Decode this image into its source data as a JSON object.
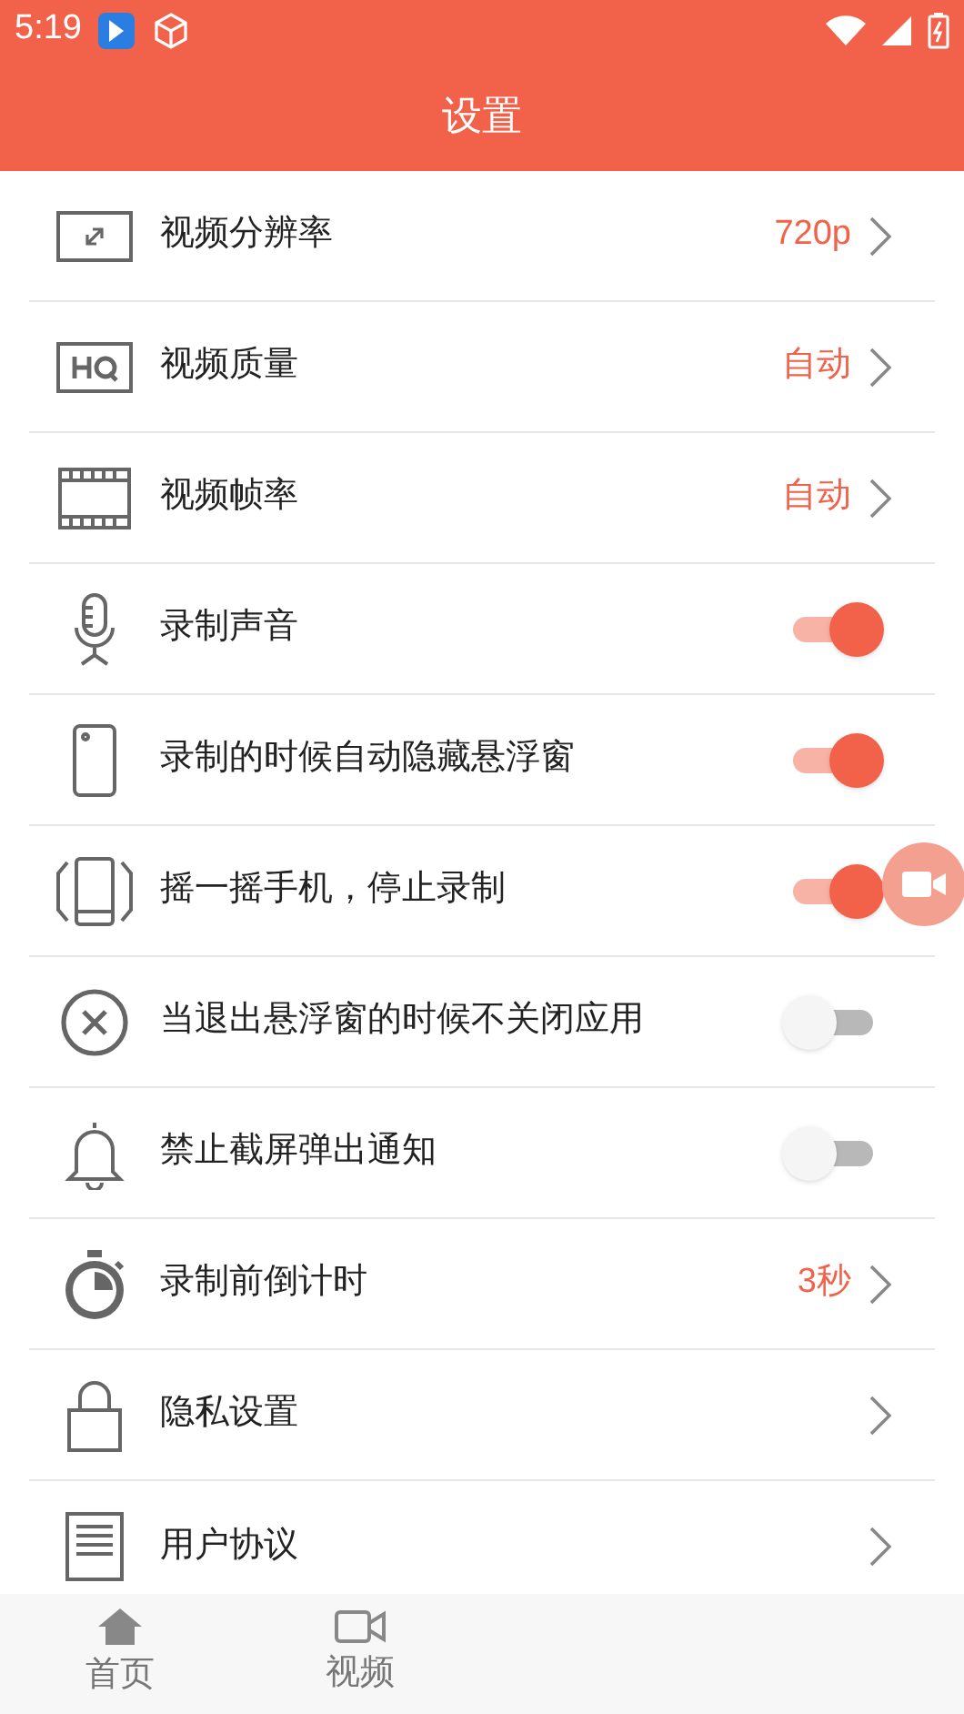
{
  "status_bar": {
    "time": "5:19"
  },
  "header": {
    "title": "设置"
  },
  "settings": [
    {
      "kind": "value",
      "label": "视频分辨率",
      "value": "720p"
    },
    {
      "kind": "value",
      "label": "视频质量",
      "value": "自动"
    },
    {
      "kind": "value",
      "label": "视频帧率",
      "value": "自动"
    },
    {
      "kind": "toggle",
      "label": "录制声音",
      "on": true
    },
    {
      "kind": "toggle",
      "label": "录制的时候自动隐藏悬浮窗",
      "on": true
    },
    {
      "kind": "toggle",
      "label": "摇一摇手机，停止录制",
      "on": true
    },
    {
      "kind": "toggle",
      "label": "当退出悬浮窗的时候不关闭应用",
      "on": false
    },
    {
      "kind": "toggle",
      "label": "禁止截屏弹出通知",
      "on": false
    },
    {
      "kind": "value",
      "label": "录制前倒计时",
      "value": "3秒"
    },
    {
      "kind": "link",
      "label": "隐私设置"
    },
    {
      "kind": "link",
      "label": "用户协议"
    }
  ],
  "bottom_nav": [
    {
      "label": "首页"
    },
    {
      "label": "视频"
    }
  ]
}
